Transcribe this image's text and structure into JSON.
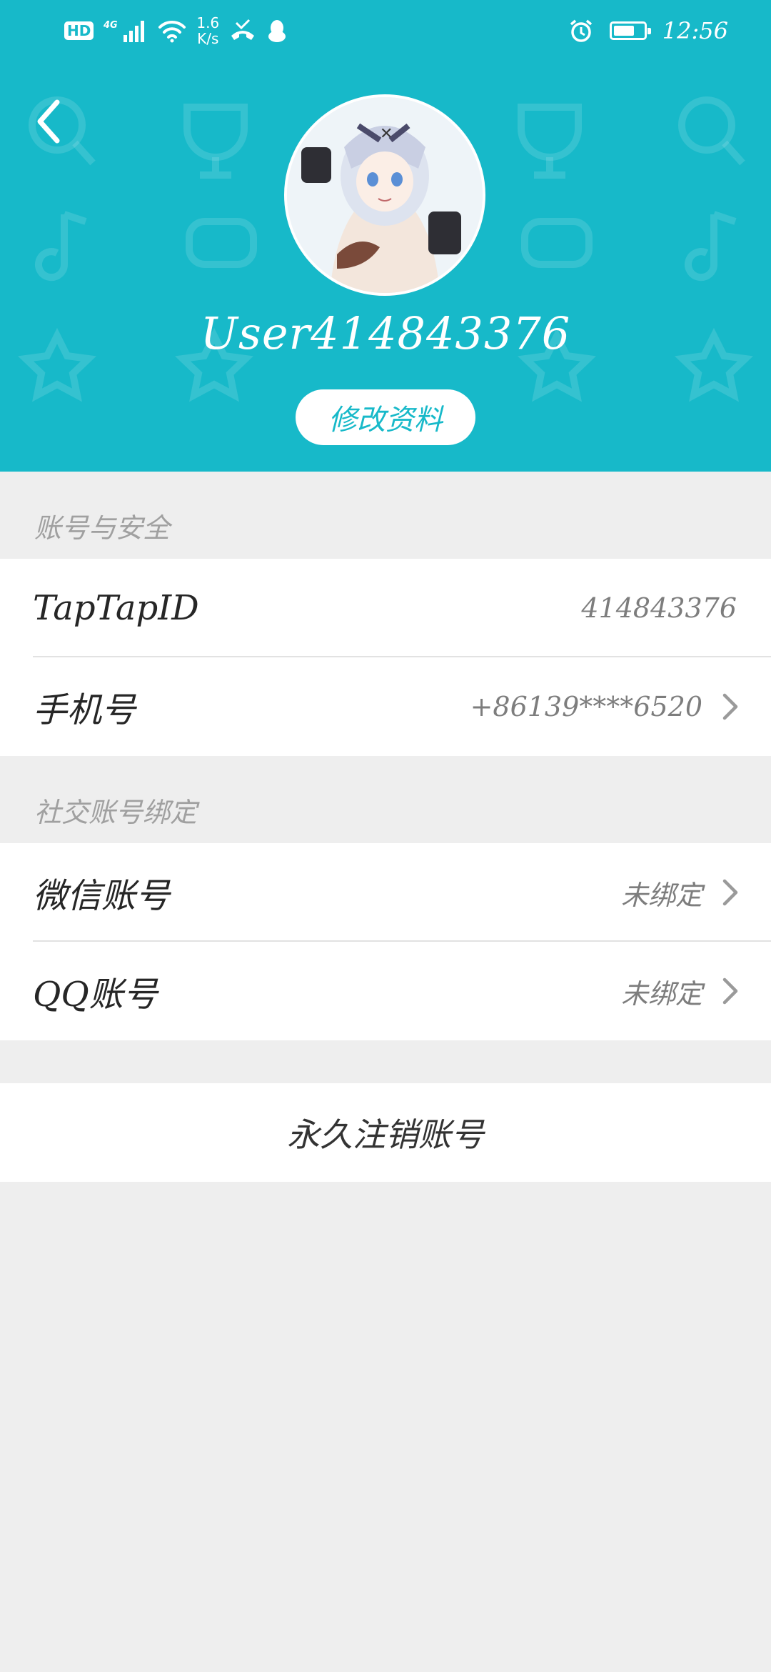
{
  "status_bar": {
    "hd": "HD",
    "network": "4G",
    "speed_value": "1.6",
    "speed_unit": "K/s",
    "time": "12:56",
    "battery_level": 0.75
  },
  "profile": {
    "username": "User414843376",
    "edit_label": "修改资料"
  },
  "account_security": {
    "title": "账号与安全",
    "rows": [
      {
        "label": "TapTapID",
        "value": "414843376"
      },
      {
        "label": "手机号",
        "value": "+86139****6520"
      }
    ]
  },
  "social_binding": {
    "title": "社交账号绑定",
    "rows": [
      {
        "label": "微信账号",
        "value": "未绑定"
      },
      {
        "label": "QQ账号",
        "value": "未绑定"
      }
    ]
  },
  "delete_account": {
    "label": "永久注销账号"
  },
  "colors": {
    "accent": "#17b9c9",
    "background": "#eeeeee"
  },
  "icons": [
    "back-arrow-icon",
    "chevron-right-icon",
    "alarm-icon",
    "battery-icon",
    "wifi-icon",
    "signal-icon",
    "missed-call-icon",
    "qq-penguin-icon"
  ]
}
